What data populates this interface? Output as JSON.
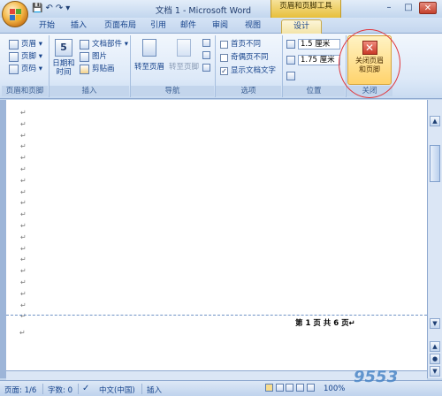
{
  "window": {
    "title": "文档 1 - Microsoft Word",
    "contextual_tab": "页眉和页脚工具",
    "controls": {
      "minimize": "–",
      "maximize": "□",
      "close": "✕"
    }
  },
  "quick_access": {
    "save": "💾",
    "undo": "↶",
    "redo": "↷",
    "more": "▾"
  },
  "tabs": [
    "开始",
    "插入",
    "页面布局",
    "引用",
    "邮件",
    "审阅",
    "视图",
    "设计"
  ],
  "active_tab": "设计",
  "ribbon": {
    "groups": {
      "header_footer": {
        "label": "页眉和页脚",
        "items": [
          "页眉 ▾",
          "页脚 ▾",
          "页码 ▾"
        ]
      },
      "insert": {
        "label": "插入",
        "date_time": "日期和\n时间",
        "date_icon_num": "5",
        "items": [
          "文档部件 ▾",
          "图片",
          "剪贴画"
        ]
      },
      "navigation": {
        "label": "导航",
        "goto_header": "转至页眉",
        "goto_footer": "转至页脚"
      },
      "options": {
        "label": "选项",
        "items": [
          {
            "label": "首页不同",
            "checked": false
          },
          {
            "label": "奇偶页不同",
            "checked": false
          },
          {
            "label": "显示文档文字",
            "checked": true
          }
        ]
      },
      "position": {
        "label": "位置",
        "header_distance": "1.5 厘米",
        "footer_distance": "1.75 厘米"
      },
      "close": {
        "label": "关闭",
        "button": "关闭页眉\n和页脚"
      }
    }
  },
  "document": {
    "paragraph_mark": "↵",
    "footer_text": "第 1 页 共 6 页↵"
  },
  "status_bar": {
    "page": "页面: 1/6",
    "words": "字数: 0",
    "language": "中文(中国)",
    "mode": "插入",
    "zoom": "100%"
  },
  "watermark": "9553"
}
